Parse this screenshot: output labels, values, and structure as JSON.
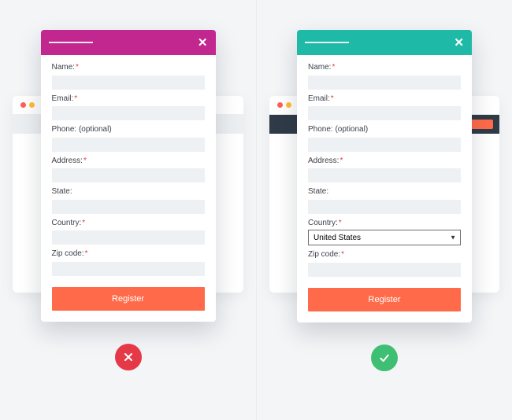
{
  "left": {
    "fields": {
      "name": {
        "label": "Name:",
        "required": true
      },
      "email": {
        "label": "Email:",
        "required": true
      },
      "phone": {
        "label": "Phone: (optional)",
        "required": false
      },
      "address": {
        "label": "Address:",
        "required": true
      },
      "state": {
        "label": "State:",
        "required": false
      },
      "country": {
        "label": "Country:",
        "required": true
      },
      "zip": {
        "label": "Zip code:",
        "required": true
      }
    },
    "submit_label": "Register",
    "verdict": "bad"
  },
  "right": {
    "fields": {
      "name": {
        "label": "Name:",
        "required": true
      },
      "email": {
        "label": "Email:",
        "required": true
      },
      "phone": {
        "label": "Phone: (optional)",
        "required": false
      },
      "address": {
        "label": "Address:",
        "required": true
      },
      "state": {
        "label": "State:",
        "required": false
      },
      "country": {
        "label": "Country:",
        "required": true,
        "value": "United States"
      },
      "zip": {
        "label": "Zip code:",
        "required": true
      }
    },
    "submit_label": "Register",
    "verdict": "good"
  },
  "colors": {
    "accent_bad": "#c2268f",
    "accent_good": "#1fb9a8",
    "cta": "#ff6b4a"
  }
}
